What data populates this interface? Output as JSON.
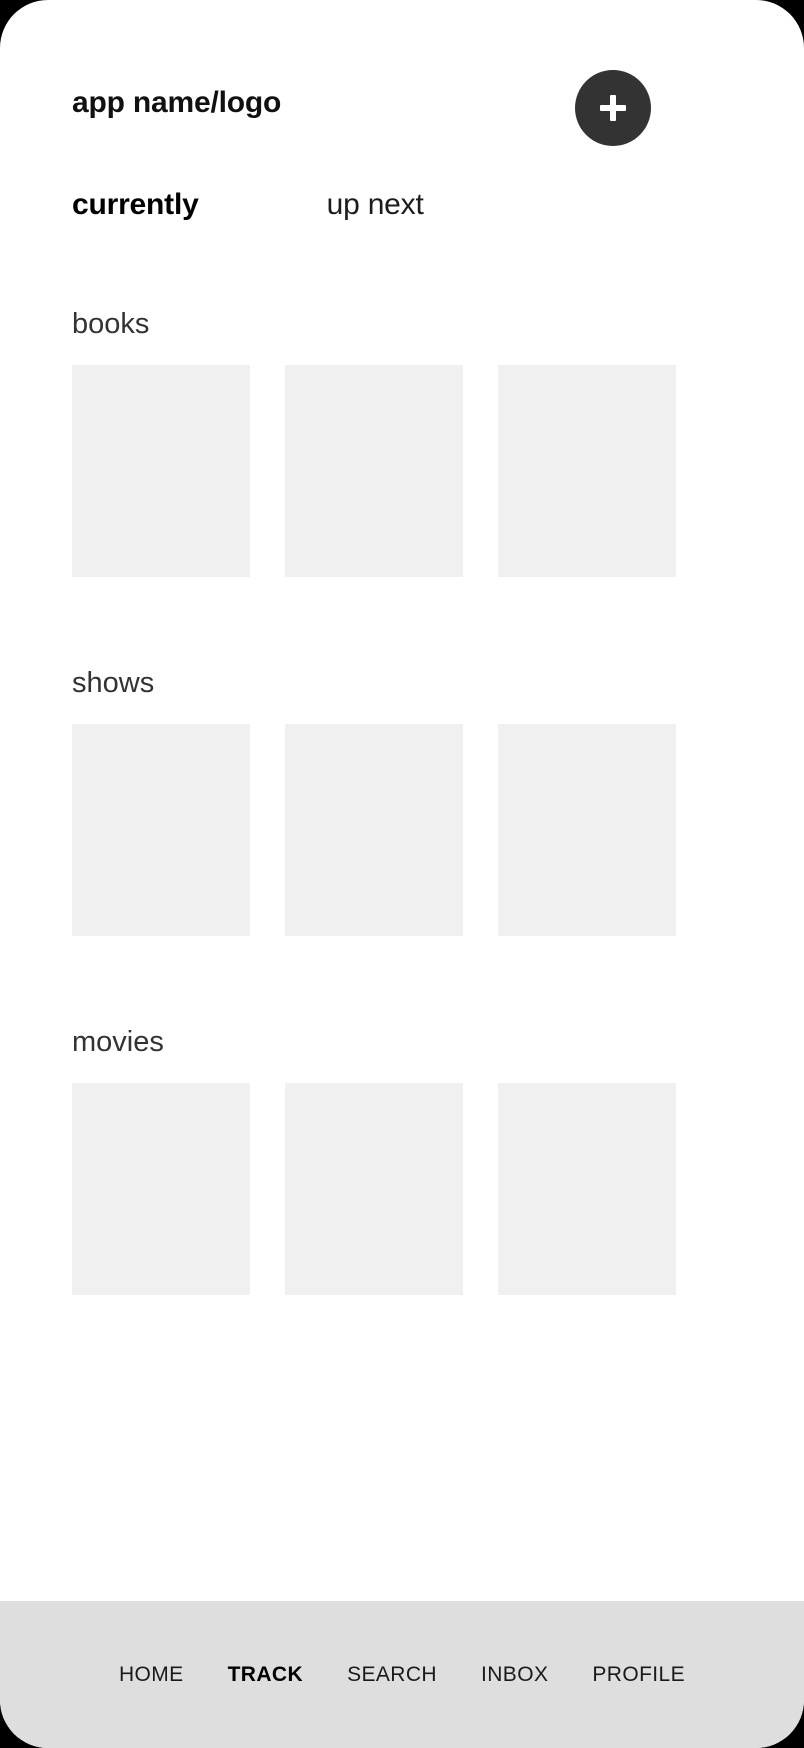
{
  "app": {
    "logo_text": "app name/logo",
    "add_button_icon": "plus-icon",
    "accent_dark": "#333333",
    "card_placeholder_color": "#f0f0f0",
    "nav_background_color": "#dedede"
  },
  "tabs": [
    {
      "label": "currently",
      "active": true
    },
    {
      "label": "up next",
      "active": false
    }
  ],
  "sections": [
    {
      "title": "books",
      "cards": [
        {
          "label": ""
        },
        {
          "label": ""
        },
        {
          "label": ""
        }
      ]
    },
    {
      "title": "shows",
      "cards": [
        {
          "label": ""
        },
        {
          "label": ""
        },
        {
          "label": ""
        }
      ]
    },
    {
      "title": "movies",
      "cards": [
        {
          "label": ""
        },
        {
          "label": ""
        },
        {
          "label": ""
        }
      ]
    }
  ],
  "bottom_nav": [
    {
      "label": "HOME",
      "active": false
    },
    {
      "label": "TRACK",
      "active": true
    },
    {
      "label": "SEARCH",
      "active": false
    },
    {
      "label": "INBOX",
      "active": false
    },
    {
      "label": "PROFILE",
      "active": false
    }
  ]
}
